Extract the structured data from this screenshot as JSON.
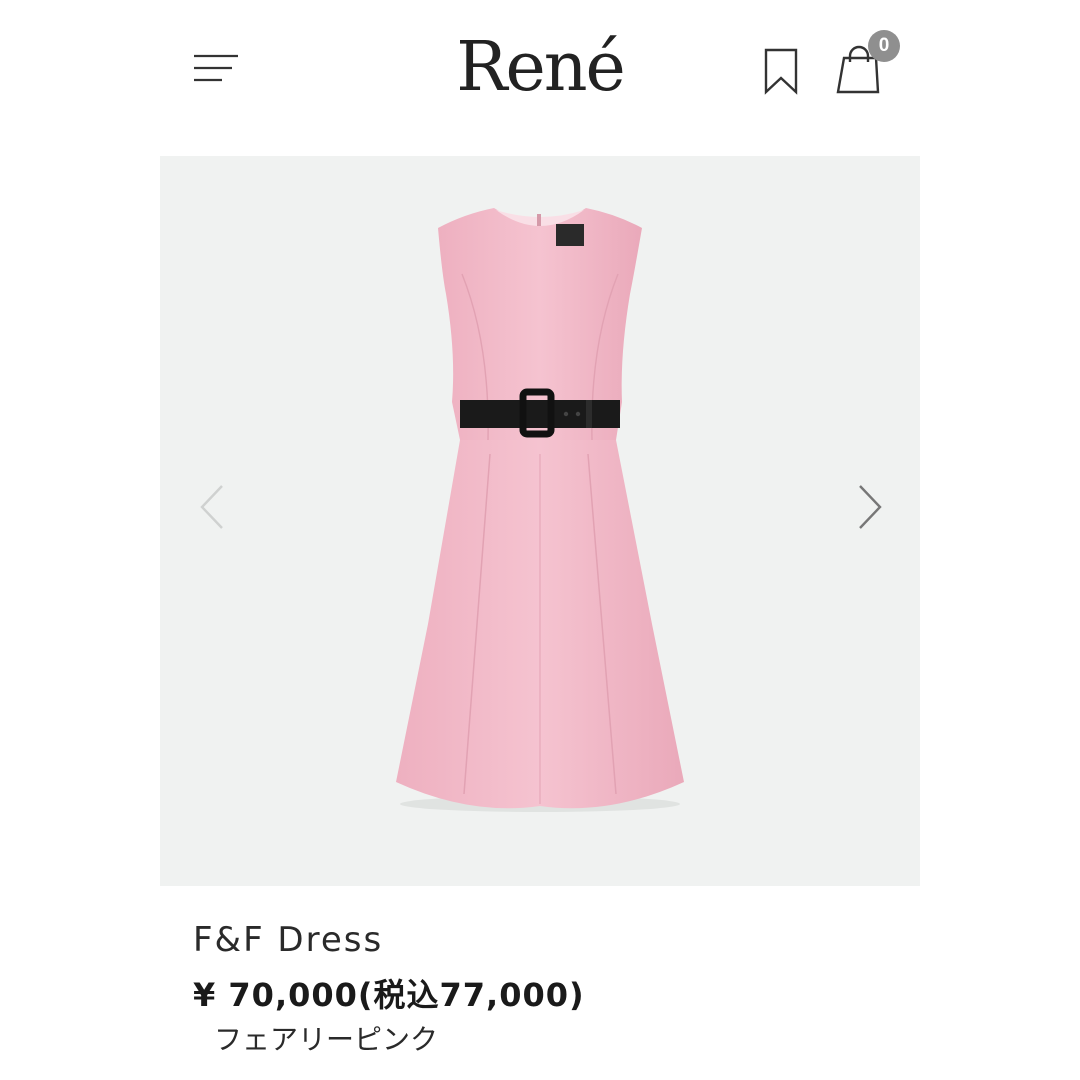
{
  "header": {
    "brand": "René",
    "cart_count": "0",
    "icons": [
      "hamburger-menu-icon",
      "bookmark-icon",
      "shopping-bag-icon"
    ]
  },
  "gallery": {
    "icons": [
      "chevron-left-icon",
      "chevron-right-icon"
    ],
    "product_colors": {
      "dress": "#f2b9c8",
      "belt": "#1a1a1a",
      "background": "#f0f2f1"
    }
  },
  "product": {
    "name": "F&F Dress",
    "price": "¥ 70,000(税込77,000)",
    "color": "フェアリーピンク"
  }
}
